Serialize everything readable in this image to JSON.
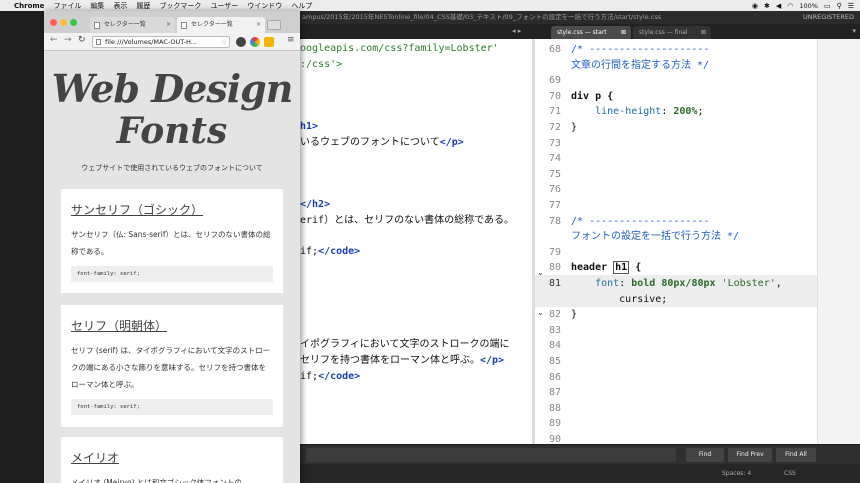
{
  "menubar": {
    "app": "Chrome",
    "items": [
      "ファイル",
      "編集",
      "表示",
      "履歴",
      "ブックマーク",
      "ユーザー",
      "ウインドウ",
      "ヘルプ"
    ],
    "battery": "100%"
  },
  "sublime": {
    "title_path": "ampus/2015年/2015年NESTonline_file/04_CSS基礎/03_テキスト/09_フォントの設定を一括で行う方法/start/style.css",
    "unregistered": "UNREGISTERED",
    "tabs": [
      {
        "label": "style.css — start",
        "close": "⊠"
      },
      {
        "label": "style.css — final",
        "close": "⊠"
      }
    ],
    "find_buttons": [
      "Find",
      "Find Prev",
      "Find All"
    ],
    "status": {
      "spaces": "Spaces: 4",
      "syntax": "CSS"
    }
  },
  "left_pane": {
    "lines": [
      {
        "parts": [
          {
            "t": "oogleapis.com/css?family=Lobster'",
            "c": "c-str"
          }
        ]
      },
      {
        "parts": [
          {
            "t": ":/css'>",
            "c": "c-str"
          }
        ]
      },
      {
        "parts": [
          {
            "t": "",
            "c": ""
          }
        ]
      },
      {
        "parts": [
          {
            "t": "",
            "c": ""
          }
        ]
      },
      {
        "parts": [
          {
            "t": "",
            "c": ""
          }
        ]
      },
      {
        "parts": [
          {
            "t": "h1>",
            "c": "c-tag"
          }
        ]
      },
      {
        "parts": [
          {
            "t": "いるウェブのフォントについて",
            "c": ""
          },
          {
            "t": "</p>",
            "c": "c-tag"
          }
        ]
      },
      {
        "parts": [
          {
            "t": "",
            "c": ""
          }
        ]
      },
      {
        "parts": [
          {
            "t": "",
            "c": ""
          }
        ]
      },
      {
        "parts": [
          {
            "t": "",
            "c": ""
          }
        ]
      },
      {
        "parts": [
          {
            "t": "</h2>",
            "c": "c-tag"
          }
        ]
      },
      {
        "parts": [
          {
            "t": "erif）とは、セリフのない書体の総称である。",
            "c": ""
          }
        ]
      },
      {
        "parts": [
          {
            "t": "",
            "c": ""
          }
        ]
      },
      {
        "parts": [
          {
            "t": "if;",
            "c": ""
          },
          {
            "t": "</code>",
            "c": "c-tag"
          }
        ]
      },
      {
        "parts": [
          {
            "t": "",
            "c": ""
          }
        ]
      },
      {
        "parts": [
          {
            "t": "",
            "c": ""
          }
        ]
      },
      {
        "parts": [
          {
            "t": "",
            "c": ""
          }
        ]
      },
      {
        "parts": [
          {
            "t": "",
            "c": ""
          }
        ]
      },
      {
        "parts": [
          {
            "t": "",
            "c": ""
          }
        ]
      },
      {
        "parts": [
          {
            "t": "イポグラフィにおいて文字のストロークの端に",
            "c": ""
          }
        ]
      },
      {
        "parts": [
          {
            "t": "セリフを持つ書体をローマン体と呼ぶ。",
            "c": ""
          },
          {
            "t": "</p>",
            "c": "c-tag"
          }
        ]
      },
      {
        "parts": [
          {
            "t": "if;",
            "c": ""
          },
          {
            "t": "</code>",
            "c": "c-tag"
          }
        ]
      }
    ]
  },
  "right_pane": {
    "lines": [
      {
        "n": "68",
        "parts": [
          {
            "t": "/* --------------------",
            "c": "c-cmt"
          }
        ]
      },
      {
        "n": "",
        "parts": [
          {
            "t": "文章の行間を指定する方法 */",
            "c": "c-cmt"
          }
        ]
      },
      {
        "n": "69",
        "parts": []
      },
      {
        "n": "70",
        "parts": [
          {
            "t": "div p {",
            "c": "c-sel"
          }
        ]
      },
      {
        "n": "71",
        "parts": [
          {
            "t": "    ",
            "c": ""
          },
          {
            "t": "line-height",
            "c": "c-prop"
          },
          {
            "t": ": ",
            "c": ""
          },
          {
            "t": "200%",
            "c": "c-val"
          },
          {
            "t": ";",
            "c": ""
          }
        ]
      },
      {
        "n": "72",
        "parts": [
          {
            "t": "}",
            "c": ""
          }
        ]
      },
      {
        "n": "73",
        "parts": []
      },
      {
        "n": "74",
        "parts": []
      },
      {
        "n": "75",
        "parts": []
      },
      {
        "n": "76",
        "parts": []
      },
      {
        "n": "77",
        "parts": []
      },
      {
        "n": "78",
        "parts": [
          {
            "t": "/* --------------------",
            "c": "c-cmt"
          }
        ]
      },
      {
        "n": "",
        "parts": [
          {
            "t": "フォントの設定を一括で行う方法 */",
            "c": "c-cmt"
          }
        ]
      },
      {
        "n": "79",
        "parts": []
      },
      {
        "n": "80",
        "parts": [
          {
            "t": "header ",
            "c": "c-sel"
          },
          {
            "t": "h1",
            "c": "c-sel c-hl"
          },
          {
            "t": " {",
            "c": "c-sel"
          }
        ]
      },
      {
        "n": "81",
        "cur": true,
        "parts": [
          {
            "t": "    ",
            "c": ""
          },
          {
            "t": "font",
            "c": "c-prop"
          },
          {
            "t": ": ",
            "c": ""
          },
          {
            "t": "bold 80px/80px ",
            "c": "c-val"
          },
          {
            "t": "'Lobster'",
            "c": "c-q"
          },
          {
            "t": ",",
            "c": ""
          }
        ]
      },
      {
        "n": "",
        "cur": true,
        "parts": [
          {
            "t": "        cursive;",
            "c": ""
          }
        ]
      },
      {
        "n": "82",
        "parts": [
          {
            "t": "}",
            "c": ""
          }
        ]
      },
      {
        "n": "83",
        "parts": []
      },
      {
        "n": "84",
        "parts": []
      },
      {
        "n": "85",
        "parts": []
      },
      {
        "n": "86",
        "parts": []
      },
      {
        "n": "87",
        "parts": []
      },
      {
        "n": "88",
        "parts": []
      },
      {
        "n": "89",
        "parts": []
      },
      {
        "n": "90",
        "parts": []
      }
    ]
  },
  "chrome": {
    "tabs": [
      "セレクター一覧",
      "セレクター一覧"
    ],
    "url": "file:///Volumes/MAC-OUT-H...",
    "page": {
      "logo_line1": "Web Design",
      "logo_line2": "Fonts",
      "subtitle": "ウェブサイトで使用されているウェブのフォントについて",
      "cards": [
        {
          "heading": "サンセリフ（ゴシック）",
          "body": "サンセリフ（仏: Sans-serif）とは、セリフのない書体の総称である。",
          "code": "font-family: serif;"
        },
        {
          "heading": "セリフ（明朝体）",
          "body": "セリフ (serif) は、タイポグラフィにおいて文字のストロークの端にある小さな飾りを意味する。セリフを持つ書体をローマン体と呼ぶ。",
          "code": "font-family: serif;"
        },
        {
          "heading": "メイリオ",
          "body": "メイリオ (Meiryo) とは和文ゴシック体フォントの"
        }
      ]
    }
  }
}
